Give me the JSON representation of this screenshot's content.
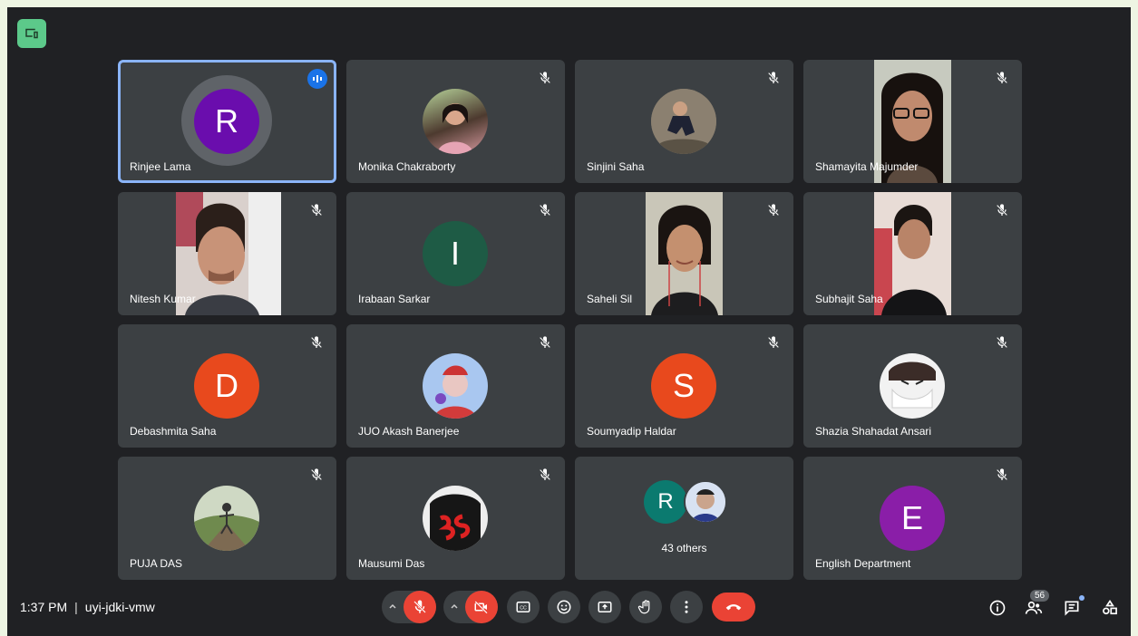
{
  "meeting": {
    "time": "1:37 PM",
    "separator": "|",
    "code": "uyi-jdki-vmw",
    "participant_count": "56"
  },
  "tiles": [
    {
      "name": "Rinjee Lama",
      "type": "initial",
      "initial": "R",
      "color": "#6a0dad",
      "speaking": true
    },
    {
      "name": "Monika Chakraborty",
      "type": "avatar-photo",
      "muted": true
    },
    {
      "name": "Sinjini Saha",
      "type": "avatar-photo",
      "muted": true
    },
    {
      "name": "Shamayita Majumder",
      "type": "video",
      "muted": true
    },
    {
      "name": "Nitesh Kumar",
      "type": "video",
      "muted": true
    },
    {
      "name": "Irabaan Sarkar",
      "type": "initial",
      "initial": "I",
      "color": "#1e5b45",
      "muted": true
    },
    {
      "name": "Saheli Sil",
      "type": "video",
      "muted": true
    },
    {
      "name": "Subhajit Saha",
      "type": "video",
      "muted": true
    },
    {
      "name": "Debashmita Saha",
      "type": "initial",
      "initial": "D",
      "color": "#e8491d",
      "muted": true
    },
    {
      "name": "JUO Akash Banerjee",
      "type": "avatar-photo",
      "muted": true
    },
    {
      "name": "Soumyadip Haldar",
      "type": "initial",
      "initial": "S",
      "color": "#e8491d",
      "muted": true
    },
    {
      "name": "Shazia Shahadat Ansari",
      "type": "avatar-photo",
      "muted": true
    },
    {
      "name": "PUJA DAS",
      "type": "avatar-photo",
      "muted": true
    },
    {
      "name": "Mausumi Das",
      "type": "avatar-photo",
      "muted": true
    },
    {
      "name": "43 others",
      "type": "others",
      "initial": "R",
      "muted": false
    },
    {
      "name": "English Department",
      "type": "initial",
      "initial": "E",
      "color": "#8a1ea8",
      "muted": true
    }
  ],
  "icons": {
    "present": "present-icon",
    "mic_off": "mic-off-icon",
    "camera_off": "camera-off-icon",
    "captions": "captions-icon",
    "emoji": "emoji-icon",
    "present_now": "present-screen-icon",
    "raise_hand": "raise-hand-icon",
    "more": "more-vert-icon",
    "end_call": "end-call-icon",
    "info": "info-icon",
    "people": "people-icon",
    "chat": "chat-icon",
    "activities": "activities-icon"
  },
  "colors": {
    "stage": "#202124",
    "tile": "#3c4043",
    "accent": "#8ab4f8",
    "danger": "#ea4335"
  }
}
